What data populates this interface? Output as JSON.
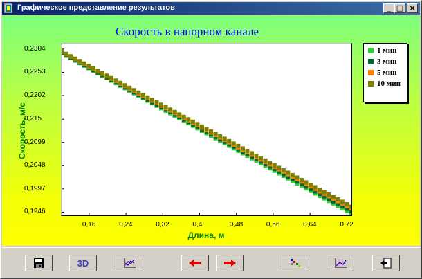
{
  "window": {
    "title": "Графическое представление результатов",
    "minimize_glyph": "_",
    "maximize_glyph": "□",
    "close_glyph": "×"
  },
  "chart_data": {
    "type": "scatter",
    "title": "Скорость в напорном канале",
    "xlabel": "Длина, м",
    "ylabel": "Скорость, м/с",
    "x_ticks": [
      "0,16",
      "0,24",
      "0,32",
      "0,4",
      "0,48",
      "0,56",
      "0,64",
      "0,72"
    ],
    "y_ticks": [
      "0,2304",
      "0,2253",
      "0,2202",
      "0,215",
      "0,2099",
      "0,2048",
      "0,1997",
      "0,1946"
    ],
    "xlim": [
      0.1,
      0.73
    ],
    "ylim": [
      0.1939,
      0.2316
    ],
    "grid": false,
    "legend_position": "right",
    "series": [
      {
        "name": "1 мин",
        "color": "#33cc33",
        "x_start": 0.1,
        "x_end": 0.73,
        "y_start": 0.2295,
        "y_end": 0.1943,
        "points": 65
      },
      {
        "name": "3 мин",
        "color": "#006633",
        "x_start": 0.1,
        "x_end": 0.73,
        "y_start": 0.2296,
        "y_end": 0.1948,
        "points": 65
      },
      {
        "name": "5 мин",
        "color": "#ff8000",
        "x_start": 0.1,
        "x_end": 0.73,
        "y_start": 0.2298,
        "y_end": 0.1954,
        "points": 65
      },
      {
        "name": "10 мин",
        "color": "#808000",
        "x_start": 0.1,
        "x_end": 0.73,
        "y_start": 0.2299,
        "y_end": 0.1958,
        "points": 65
      }
    ]
  },
  "toolbar": {
    "buttons": [
      {
        "name": "save-button",
        "icon": "floppy-disk-icon"
      },
      {
        "name": "3d-view-button",
        "icon": "3d-icon",
        "label": "3D"
      },
      {
        "name": "chart-view-button",
        "icon": "line-chart-icon"
      },
      {
        "name": "previous-button",
        "icon": "arrow-left-icon"
      },
      {
        "name": "next-button",
        "icon": "arrow-right-icon"
      },
      {
        "name": "markers-button",
        "icon": "scatter-points-icon"
      },
      {
        "name": "grid-chart-button",
        "icon": "grid-chart-icon"
      },
      {
        "name": "exit-button",
        "icon": "exit-door-icon"
      }
    ]
  }
}
